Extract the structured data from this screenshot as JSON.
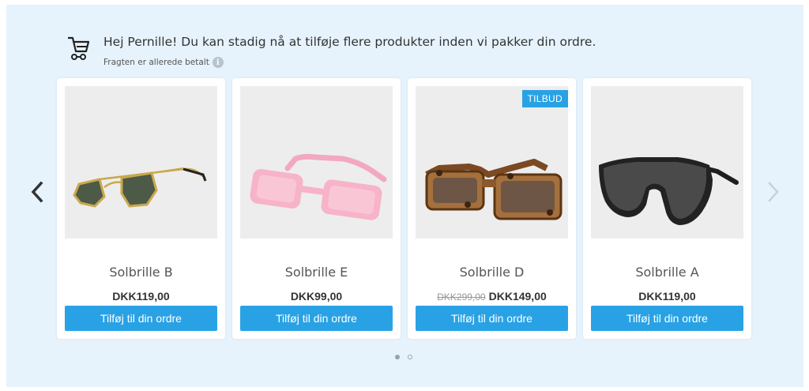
{
  "header": {
    "cart_icon": "shopping-cart-icon",
    "headline": "Hej Pernille! Du kan stadig nå at tilføje flere produkter inden vi pakker din ordre.",
    "subline": "Fragten er allerede betalt",
    "info_icon": "info-icon",
    "info_glyph": "i"
  },
  "carousel": {
    "prev_icon": "chevron-left-icon",
    "next_icon": "chevron-right-icon",
    "products": [
      {
        "name": "Solbrille B",
        "price": "DKK119,00",
        "old_price": "",
        "badge": "",
        "button": "Tilføj til din ordre"
      },
      {
        "name": "Solbrille E",
        "price": "DKK99,00",
        "old_price": "",
        "badge": "",
        "button": "Tilføj til din ordre"
      },
      {
        "name": "Solbrille D",
        "price": "DKK149,00",
        "old_price": "DKK299,00",
        "badge": "TILBUD",
        "button": "Tilføj til din ordre"
      },
      {
        "name": "Solbrille A",
        "price": "DKK119,00",
        "old_price": "",
        "badge": "",
        "button": "Tilføj til din ordre"
      }
    ],
    "pagination": {
      "pages": 2,
      "current": 1
    }
  },
  "colors": {
    "panel_bg": "#e6f3fc",
    "accent": "#29a2e5",
    "text": "#333333"
  }
}
